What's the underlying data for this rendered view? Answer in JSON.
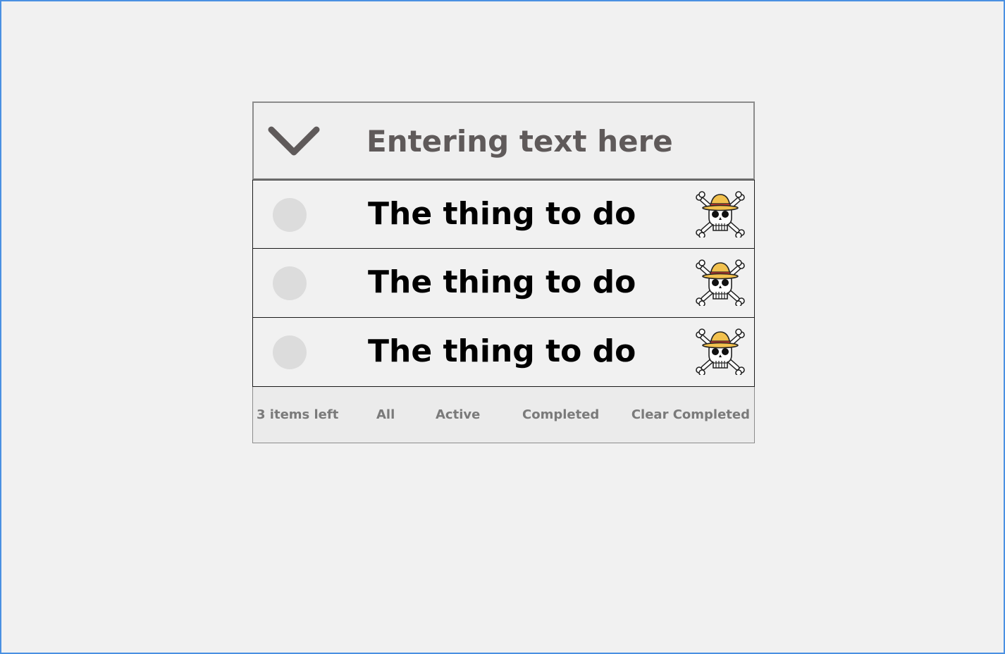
{
  "new_todo": {
    "value": "Entering text here"
  },
  "toggle_all_icon": "chevron-down-icon",
  "destroy_icon": "straw-hat-jolly-roger-icon",
  "todos": [
    {
      "label": "The thing to do",
      "completed": false
    },
    {
      "label": "The thing to do",
      "completed": false
    },
    {
      "label": "The thing to do",
      "completed": false
    }
  ],
  "footer": {
    "count": "3 items left",
    "filters": [
      "All",
      "Active",
      "Completed"
    ],
    "clear": "Clear Completed"
  },
  "colors": {
    "page_background": "#f1f1f1",
    "frame_border": "#4a90e2",
    "input_text": "#5f5a5a",
    "checkbox": "#dcdcdc",
    "footer_text": "#7a7a7a",
    "hat_yellow": "#f2c14e",
    "hat_band": "#e03c31"
  }
}
